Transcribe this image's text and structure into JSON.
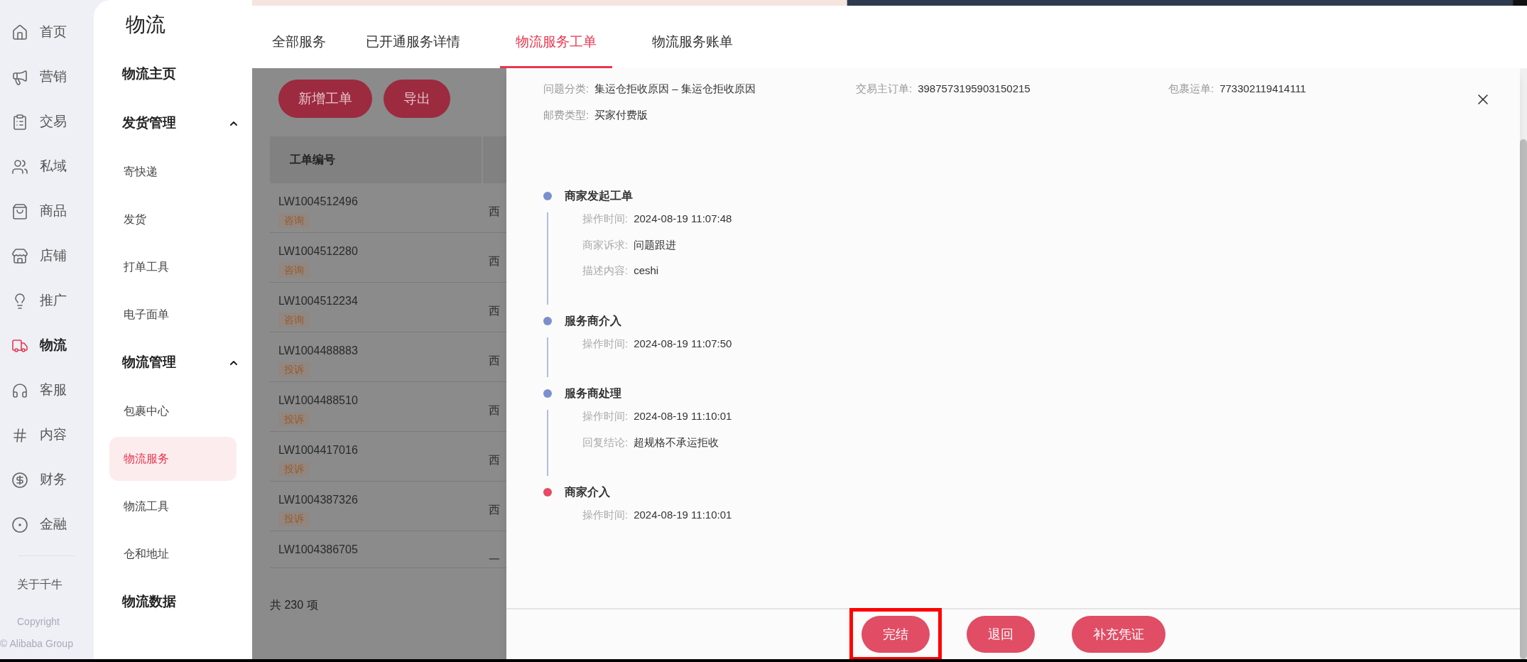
{
  "nav": {
    "items": [
      {
        "label": "首页",
        "selected": false
      },
      {
        "label": "营销",
        "selected": false
      },
      {
        "label": "交易",
        "selected": false
      },
      {
        "label": "私域",
        "selected": false
      },
      {
        "label": "商品",
        "selected": false
      },
      {
        "label": "店铺",
        "selected": false
      },
      {
        "label": "推广",
        "selected": false
      },
      {
        "label": "物流",
        "selected": true
      },
      {
        "label": "客服",
        "selected": false
      },
      {
        "label": "内容",
        "selected": false
      },
      {
        "label": "财务",
        "selected": false
      },
      {
        "label": "金融",
        "selected": false
      }
    ],
    "about": "关于千牛",
    "copyright": "Copyright",
    "company": "© Alibaba Group"
  },
  "sidebar": {
    "title": "物流",
    "items": [
      {
        "label": "物流主页",
        "selected": false
      },
      {
        "label": "发货管理",
        "expanded": true,
        "children": [
          {
            "label": "寄快递",
            "selected": false
          },
          {
            "label": "发货",
            "selected": false
          },
          {
            "label": "打单工具",
            "selected": false
          },
          {
            "label": "电子面单",
            "selected": false
          }
        ]
      },
      {
        "label": "物流管理",
        "expanded": true,
        "children": [
          {
            "label": "包裹中心",
            "selected": false
          },
          {
            "label": "物流服务",
            "selected": true
          },
          {
            "label": "物流工具",
            "selected": false
          },
          {
            "label": "仓和地址",
            "selected": false
          }
        ]
      },
      {
        "label": "物流数据",
        "selected": false
      }
    ]
  },
  "tabs": [
    {
      "label": "全部服务",
      "selected": false
    },
    {
      "label": "已开通服务详情",
      "selected": false
    },
    {
      "label": "物流服务工单",
      "selected": true
    },
    {
      "label": "物流服务账单",
      "selected": false
    }
  ],
  "toolbar": [
    "新增工单",
    "导出"
  ],
  "table": {
    "columns": [
      "工单编号"
    ],
    "rows": [
      {
        "id": "LW1004512496",
        "tag": "咨询",
        "column_2": "西"
      },
      {
        "id": "LW1004512280",
        "tag": "咨询",
        "column_2": "西"
      },
      {
        "id": "LW1004512234",
        "tag": "咨询",
        "column_2": "西"
      },
      {
        "id": "LW1004488883",
        "tag": "投诉",
        "column_2": "西"
      },
      {
        "id": "LW1004488510",
        "tag": "投诉",
        "column_2": "西"
      },
      {
        "id": "LW1004417016",
        "tag": "投诉",
        "column_2": "西"
      },
      {
        "id": "LW1004387326",
        "tag": "投诉",
        "column_2": "西"
      },
      {
        "id": "LW1004386705",
        "column_2": "一"
      }
    ],
    "total": "共 230 项"
  },
  "drawer": {
    "info": [
      [
        {
          "label": "问题分类:",
          "value": "集运仓拒收原因 – 集运仓拒收原因"
        },
        {
          "label": "交易主订单:",
          "value": "3987573195903150215"
        },
        {
          "label": "包裹运单:",
          "value": "773302119414111"
        }
      ],
      [
        {
          "label": "邮费类型:",
          "value": "买家付费版"
        }
      ]
    ],
    "timeline": [
      {
        "title": "商家发起工单",
        "color": "#7b8fce",
        "fields": [
          {
            "label": "操作时间:",
            "value": "2024-08-19 11:07:48"
          },
          {
            "label": "商家诉求:",
            "value": "问题跟进"
          },
          {
            "label": "描述内容:",
            "value": "ceshi"
          }
        ]
      },
      {
        "title": "服务商介入",
        "color": "#7b8fce",
        "fields": [
          {
            "label": "操作时间:",
            "value": "2024-08-19 11:07:50"
          }
        ]
      },
      {
        "title": "服务商处理",
        "color": "#7b8fce",
        "fields": [
          {
            "label": "操作时间:",
            "value": "2024-08-19 11:10:01"
          },
          {
            "label": "回复结论:",
            "value": "超规格不承运拒收"
          }
        ]
      },
      {
        "title": "商家介入",
        "color": "#e84a63",
        "fields": [
          {
            "label": "操作时间:",
            "value": "2024-08-19 11:10:01"
          }
        ]
      }
    ],
    "buttons": [
      {
        "label": "完结",
        "highlighted": true
      },
      {
        "label": "退回",
        "highlighted": false
      },
      {
        "label": "补充凭证",
        "highlighted": false
      }
    ]
  }
}
